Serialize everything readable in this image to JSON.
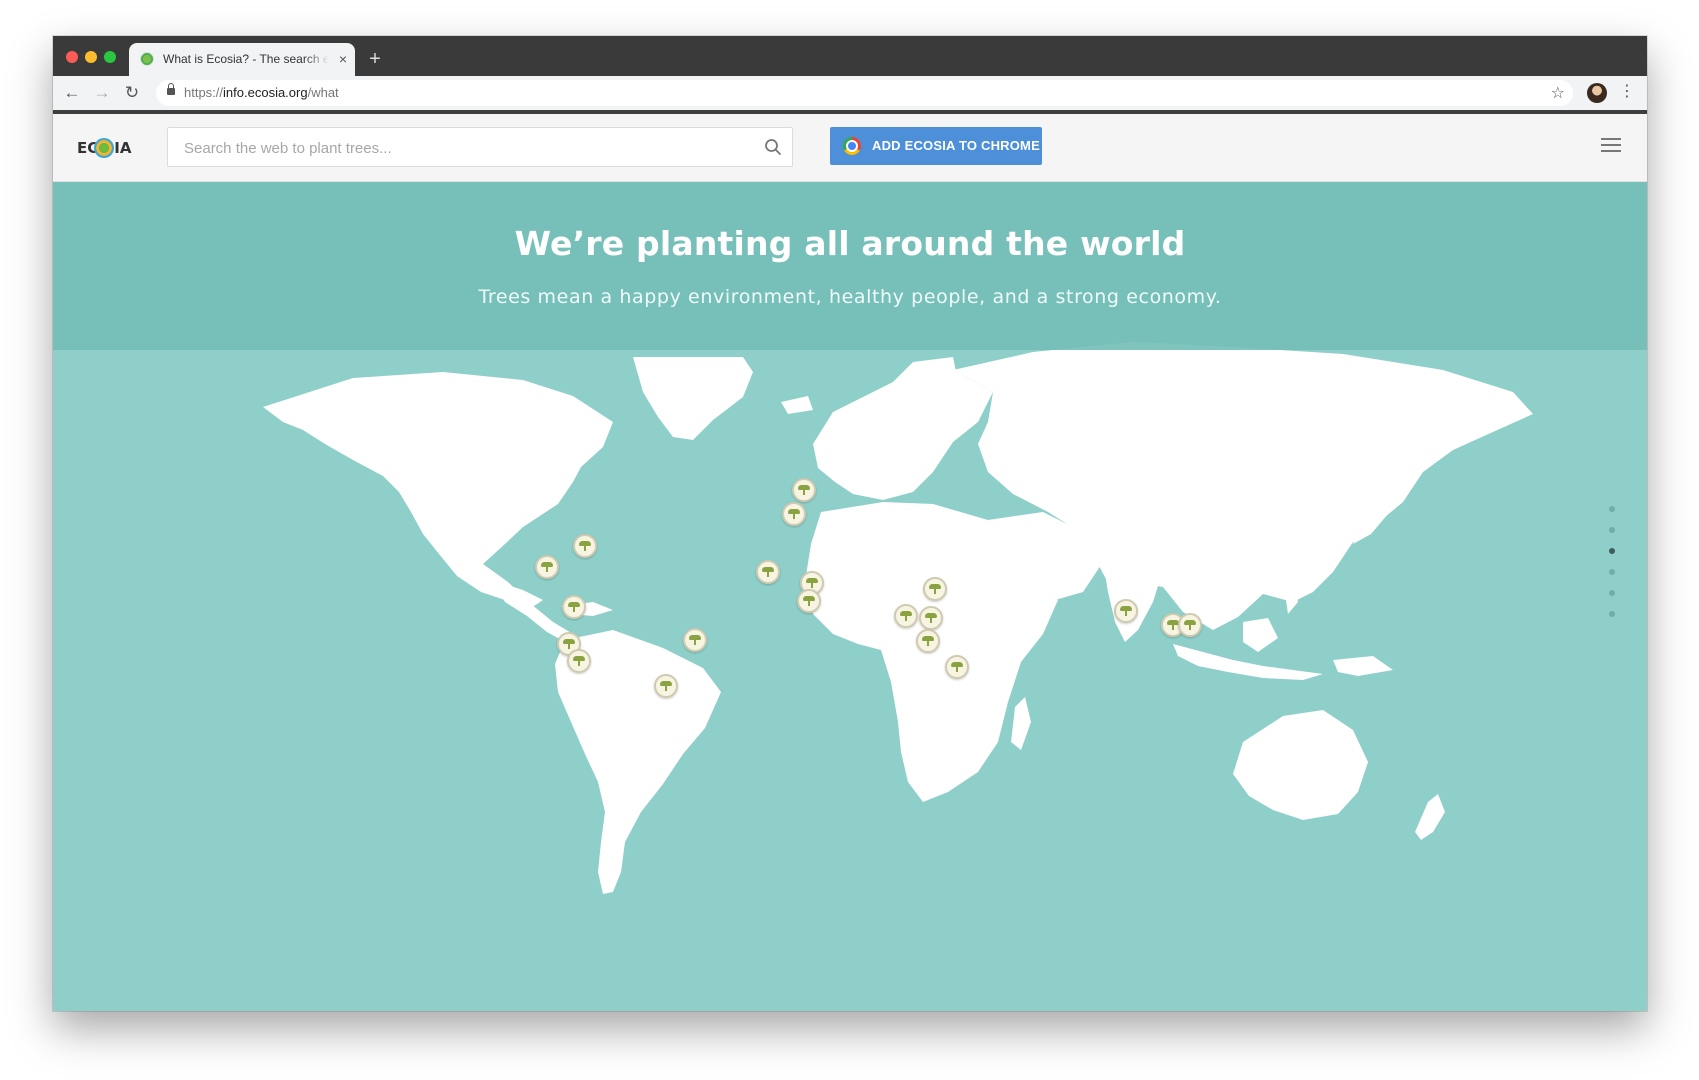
{
  "browser": {
    "tab_title": "What is Ecosia? - The search engine that plants trees",
    "tab_close": "×",
    "new_tab": "+",
    "back": "←",
    "forward": "→",
    "reload": "↻",
    "url_scheme": "https://",
    "url_host": "info.ecosia.org",
    "url_path": "/what",
    "star": "☆",
    "menu": "⋮"
  },
  "site": {
    "logo_text": "EC  SIA",
    "search_placeholder": "Search the web to plant trees...",
    "cta_label": "ADD ECOSIA TO CHROME"
  },
  "hero": {
    "title": "We’re planting all around the world",
    "subtitle": "Trees mean a happy environment, healthy people, and a strong economy."
  },
  "map": {
    "land_color": "#ffffff",
    "ocean_color": "#8ecfca",
    "marker_icon": "tree-icon",
    "project_markers": 23
  },
  "pager": {
    "count": 6,
    "active_index": 2
  }
}
